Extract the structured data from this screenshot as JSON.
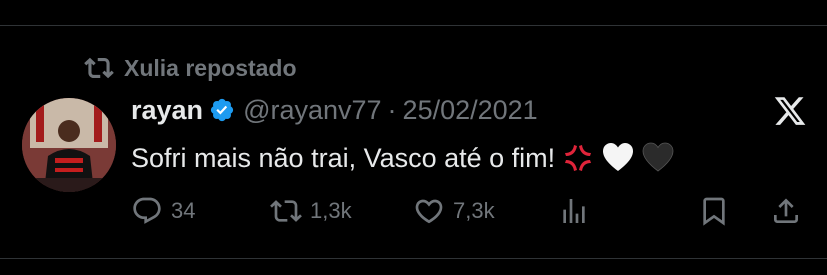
{
  "repost": {
    "label": "Xulia repostado",
    "icon": "repost-icon"
  },
  "tweet": {
    "display_name": "rayan",
    "handle": "@rayanv77",
    "separator": "·",
    "date": "25/02/2021",
    "text": "Sofri mais não trai, Vasco até o fim!",
    "emojis": [
      "anger-symbol-emoji",
      "white-heart-emoji",
      "black-heart-emoji"
    ]
  },
  "actions": {
    "replies": "34",
    "reposts": "1,3k",
    "likes": "7,3k"
  },
  "colors": {
    "background": "#000000",
    "text": "#e7e9ea",
    "muted": "#71767b",
    "verified": "#1d9bf0",
    "divider": "#2f3336"
  }
}
